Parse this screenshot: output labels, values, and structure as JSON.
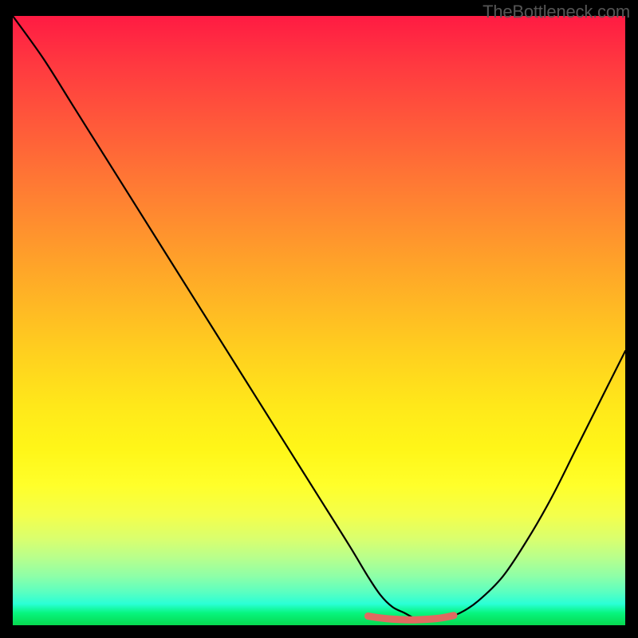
{
  "watermark": "TheBottleneck.com",
  "chart_data": {
    "type": "line",
    "title": "",
    "xlabel": "",
    "ylabel": "",
    "xlim": [
      0,
      100
    ],
    "ylim": [
      0,
      100
    ],
    "series": [
      {
        "name": "curve",
        "x": [
          0,
          5,
          10,
          15,
          20,
          25,
          30,
          35,
          40,
          45,
          50,
          55,
          58,
          60,
          62,
          64,
          66,
          68,
          70,
          73,
          76,
          80,
          84,
          88,
          92,
          96,
          100
        ],
        "values": [
          100,
          93,
          85,
          77,
          69,
          61,
          53,
          45,
          37,
          29,
          21,
          13,
          8,
          5,
          3,
          2,
          1,
          1,
          1,
          2,
          4,
          8,
          14,
          21,
          29,
          37,
          45
        ]
      },
      {
        "name": "flat-valley-highlight",
        "color": "#e06a60",
        "x": [
          58,
          60,
          62,
          64,
          66,
          68,
          70,
          72
        ],
        "values": [
          1.5,
          1.2,
          1.0,
          0.9,
          0.9,
          1.0,
          1.2,
          1.6
        ]
      }
    ]
  }
}
